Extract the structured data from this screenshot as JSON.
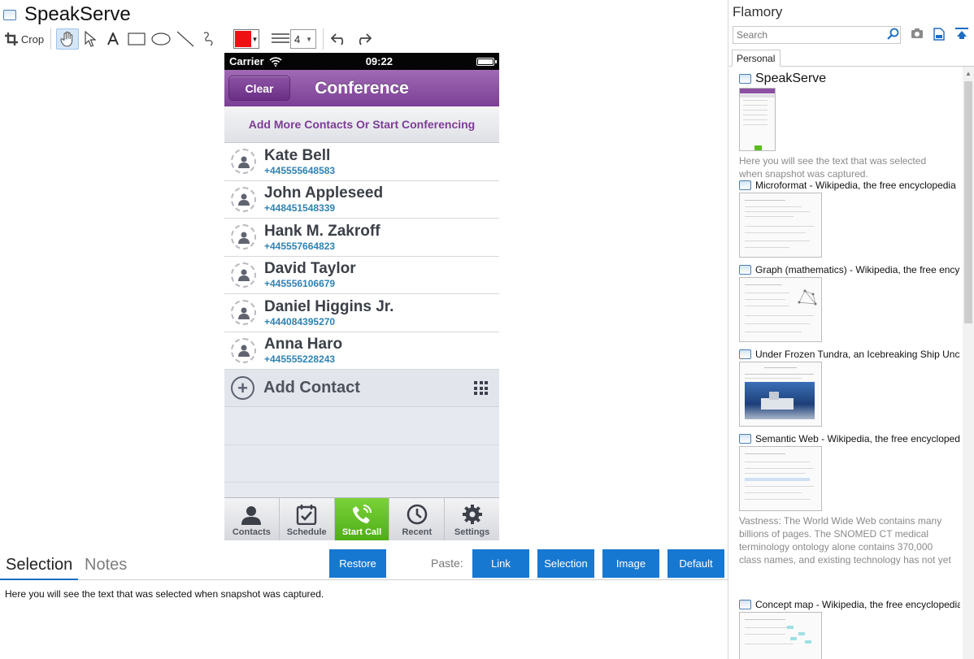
{
  "app": {
    "title": "SpeakServe"
  },
  "toolbar": {
    "crop_label": "Crop",
    "line_width": "4",
    "colors": {
      "pen": "#ee1111",
      "active_tool_bg": "#d5e6f8"
    }
  },
  "phone": {
    "status": {
      "carrier": "Carrier",
      "time": "09:22"
    },
    "navbar": {
      "clear_label": "Clear",
      "title": "Conference"
    },
    "banner": "Add More Contacts Or Start Conferencing",
    "contacts": [
      {
        "name": "Kate Bell",
        "phone": "+445555648583"
      },
      {
        "name": "John Appleseed",
        "phone": "+448451548339"
      },
      {
        "name": "Hank M. Zakroff",
        "phone": "+445557664823"
      },
      {
        "name": "David Taylor",
        "phone": "+445556106679"
      },
      {
        "name": "Daniel Higgins Jr.",
        "phone": "+444084395270"
      },
      {
        "name": "Anna Haro",
        "phone": "+445555228243"
      }
    ],
    "add_contact_label": "Add Contact",
    "tabs": [
      {
        "label": "Contacts",
        "icon": "person-icon"
      },
      {
        "label": "Schedule",
        "icon": "calendar-icon"
      },
      {
        "label": "Start Call",
        "icon": "phone-icon",
        "active": true
      },
      {
        "label": "Recent",
        "icon": "clock-icon"
      },
      {
        "label": "Settings",
        "icon": "gear-icon"
      }
    ],
    "colors": {
      "navbar": "#8b4fa3",
      "banner_text": "#7d3d96",
      "phone_number": "#2d82b5",
      "active_tab": "#5dbb21"
    }
  },
  "bottom": {
    "tab_selection": "Selection",
    "tab_notes": "Notes",
    "restore_label": "Restore",
    "paste_label": "Paste:",
    "paste_buttons": [
      "Link",
      "Selection",
      "Image",
      "Default"
    ],
    "selection_text": "Here you will see the text that was selected when snapshot was captured.",
    "colors": {
      "button": "#1778d2"
    }
  },
  "sidebar": {
    "title": "Flamory",
    "search_placeholder": "Search",
    "tab_personal": "Personal",
    "entries": [
      {
        "title": "SpeakServe",
        "snippet": "Here you will see the text that was selected when snapshot was captured."
      },
      {
        "title": "Microformat - Wikipedia, the free encyclopedia"
      },
      {
        "title": "Graph (mathematics) - Wikipedia, the free ency"
      },
      {
        "title": "Under Frozen Tundra, an Icebreaking Ship Unco"
      },
      {
        "title": "Semantic Web - Wikipedia, the free encycloped",
        "snippet": "Vastness: The World Wide Web contains many billions of pages. The SNOMED CT medical terminology ontology alone contains 370,000 class names, and existing technology has not yet been able to eliminate all semantically duplicated terms. Any automated reasoning system will have to deal with truly huge inputs."
      },
      {
        "title": "Concept map - Wikipedia, the free encyclopedia"
      }
    ]
  }
}
